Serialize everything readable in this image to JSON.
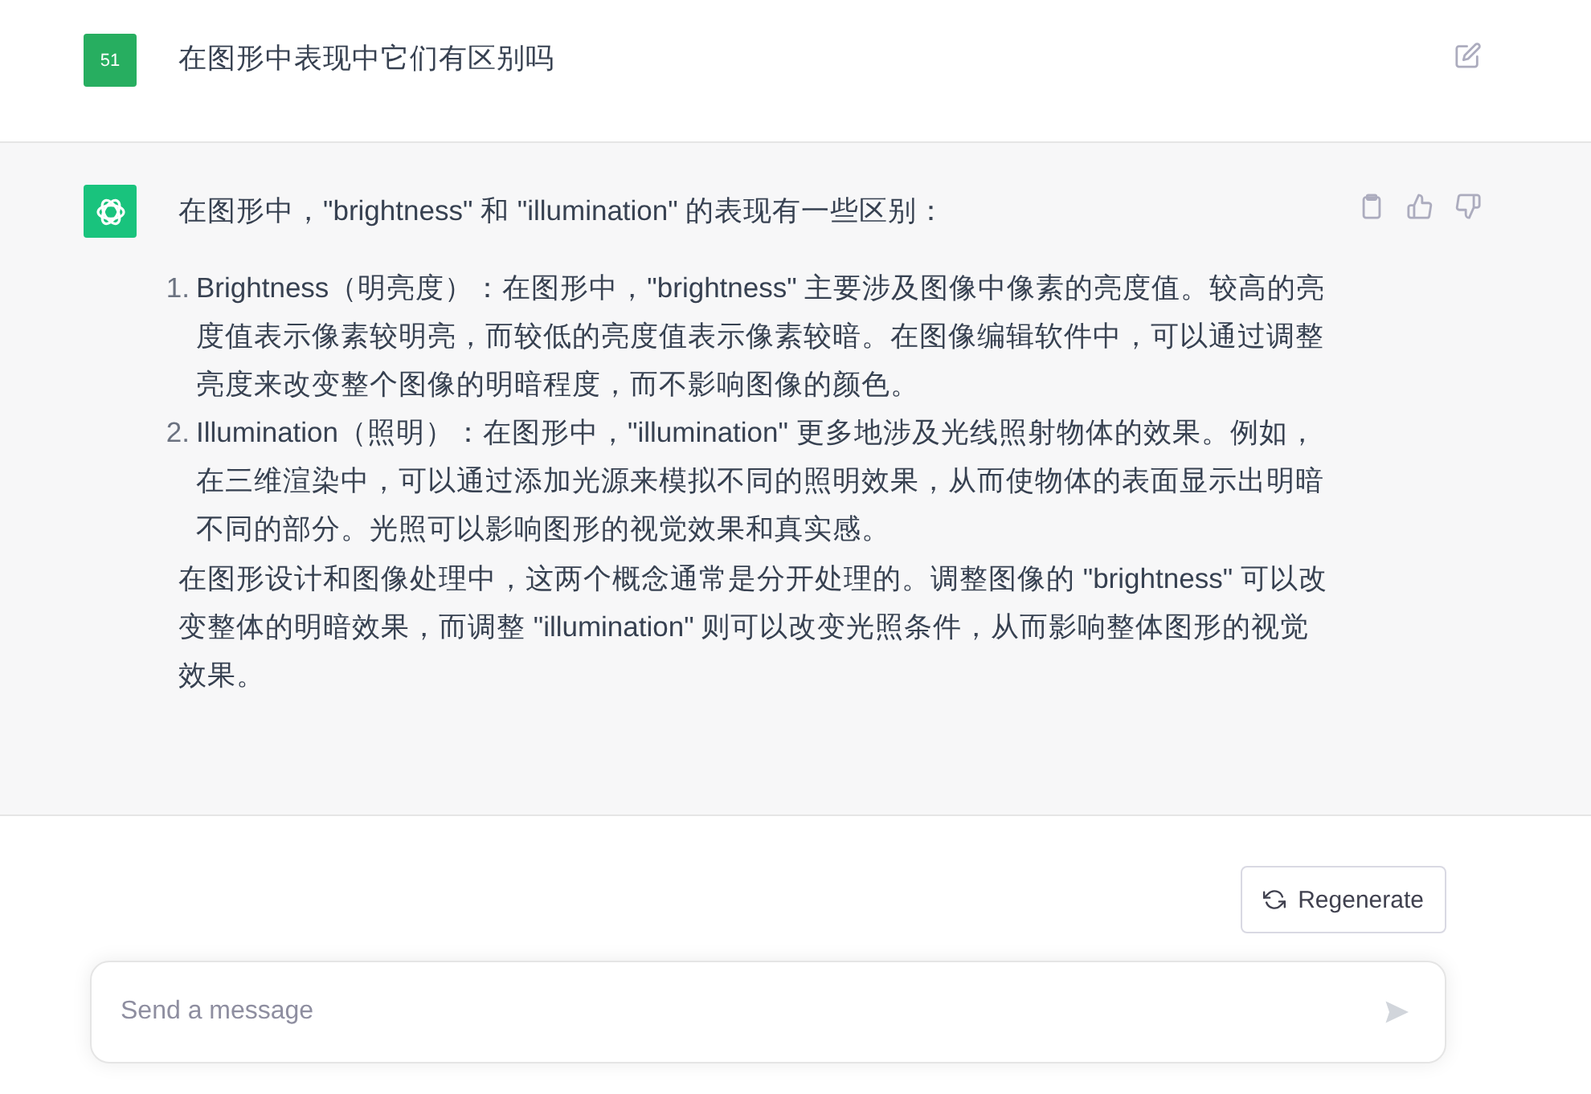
{
  "conversation": [
    {
      "kind": "user",
      "avatar": "51",
      "text": "在图形中表现中它们有区别吗"
    },
    {
      "kind": "assistant",
      "text": "在图形中，\"brightness\" 和 \"illumination\" 的表现有一些区别：",
      "list": [
        {
          "number": "1.",
          "text": "Brightness（明亮度）：在图形中，\"brightness\" 主要涉及图像中像素的亮度值。较高的亮度值表示像素较明亮，而较低的亮度值表示像素较暗。在图像编辑软件中，可以通过调整亮度来改变整个图像的明暗程度，而不影响图像的颜色。"
        },
        {
          "number": "2.",
          "text": "Illumination（照明）：在图形中，\"illumination\" 更多地涉及光线照射物体的效果。例如，在三维渲染中，可以通过添加光源来模拟不同的照明效果，从而使物体的表面显示出明暗不同的部分。光照可以影响图形的视觉效果和真实感。"
        }
      ],
      "closing": "在图形设计和图像处理中，这两个概念通常是分开处理的。调整图像的 \"brightness\" 可以改变整体的明暗效果，而调整 \"illumination\" 则可以改变光照条件，从而影响整体图形的视觉效果。"
    }
  ],
  "regenerate_button": "Regenerate",
  "composer": {
    "placeholder": "Send a message"
  }
}
